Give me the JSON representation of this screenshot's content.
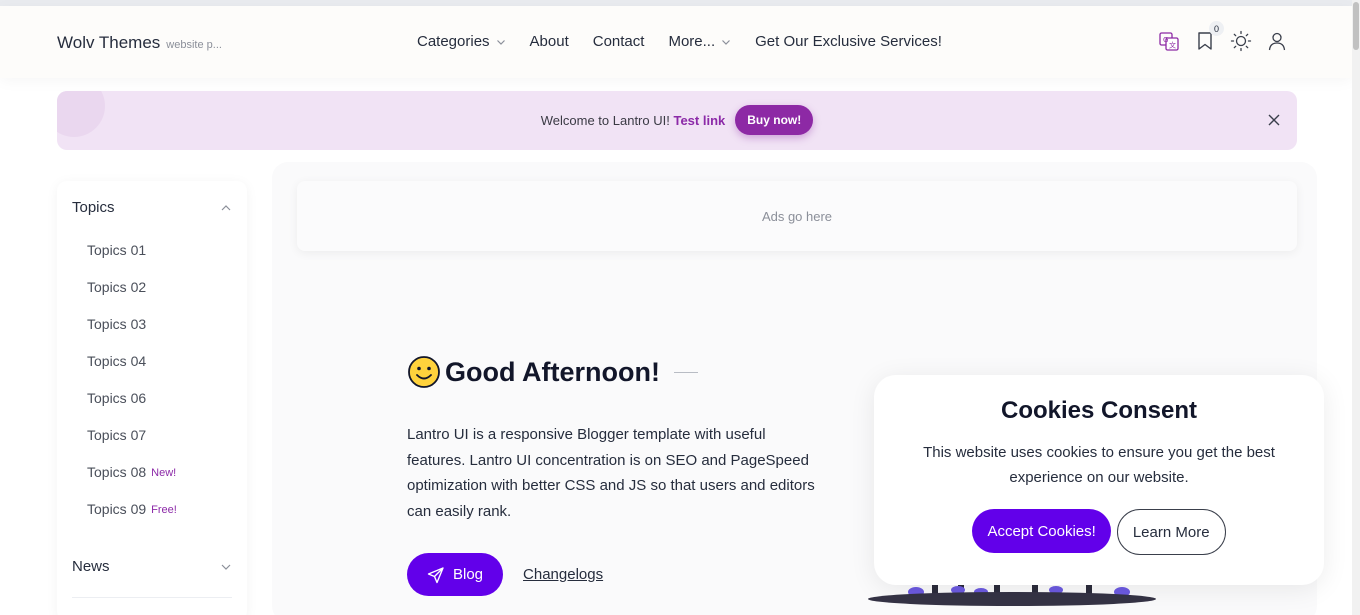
{
  "header": {
    "brand_name": "Wolv Themes",
    "brand_desc": "website p...",
    "nav": [
      {
        "label": "Categories",
        "has_dropdown": true
      },
      {
        "label": "About",
        "has_dropdown": false
      },
      {
        "label": "Contact",
        "has_dropdown": false
      },
      {
        "label": "More...",
        "has_dropdown": true
      },
      {
        "label": "Get Our Exclusive Services!",
        "has_dropdown": false
      }
    ],
    "icons": [
      "translate-icon",
      "bookmark-icon",
      "theme-toggle-icon",
      "user-icon"
    ],
    "bookmark_count": "0"
  },
  "notice": {
    "text": "Welcome to Lantro UI!",
    "link": "Test link",
    "button": "Buy now!"
  },
  "sidebar": {
    "topics_heading": "Topics",
    "topics": [
      {
        "label": "Topics 01",
        "tag": ""
      },
      {
        "label": "Topics 02",
        "tag": ""
      },
      {
        "label": "Topics 03",
        "tag": ""
      },
      {
        "label": "Topics 04",
        "tag": ""
      },
      {
        "label": "Topics 06",
        "tag": ""
      },
      {
        "label": "Topics 07",
        "tag": ""
      },
      {
        "label": "Topics 08",
        "tag": "New!"
      },
      {
        "label": "Topics 09",
        "tag": "Free!"
      }
    ],
    "news_heading": "News"
  },
  "main": {
    "ads_text": "Ads go here",
    "greeting": "Good Afternoon!",
    "intro": "Lantro UI is a responsive Blogger template with useful features. Lantro UI concentration is on SEO and PageSpeed optimization with better CSS and JS so that users and editors can easily rank.",
    "blog_button": "Blog",
    "changelog_link": "Changelogs"
  },
  "cookie": {
    "title": "Cookies Consent",
    "text": "This website uses cookies to ensure you get the best experience on our website.",
    "accept": "Accept Cookies!",
    "learn": "Learn More"
  },
  "colors": {
    "accent": "#6200ea",
    "notice_bg": "#f1e3f5",
    "notice_accent": "#8d29a5"
  }
}
